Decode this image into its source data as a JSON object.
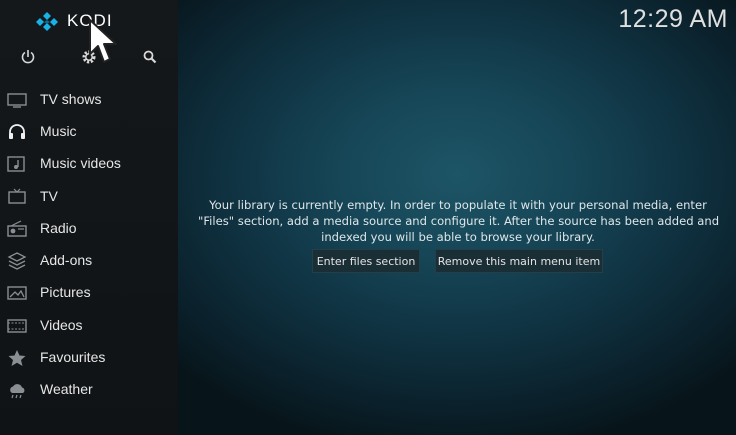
{
  "app": {
    "name": "KODI",
    "clock": "12:29 AM"
  },
  "topbar": {
    "icons": [
      "power-icon",
      "settings-icon",
      "search-icon"
    ]
  },
  "sidebar": {
    "items": [
      {
        "label": "TV shows",
        "icon": "tv-shows-icon"
      },
      {
        "label": "Music",
        "icon": "headphones-icon"
      },
      {
        "label": "Music videos",
        "icon": "music-video-icon"
      },
      {
        "label": "TV",
        "icon": "tv-icon"
      },
      {
        "label": "Radio",
        "icon": "radio-icon"
      },
      {
        "label": "Add-ons",
        "icon": "addons-icon"
      },
      {
        "label": "Pictures",
        "icon": "pictures-icon"
      },
      {
        "label": "Videos",
        "icon": "film-icon"
      },
      {
        "label": "Favourites",
        "icon": "star-icon"
      },
      {
        "label": "Weather",
        "icon": "weather-icon"
      }
    ]
  },
  "main": {
    "message_line1": "Your library is currently empty. In order to populate it with your personal media, enter",
    "message_line2": "\"Files\" section, add a media source and configure it. After the source has been added and",
    "message_line3": "indexed you will be able to browse your library.",
    "enter_files_label": "Enter files section",
    "remove_item_label": "Remove this main menu item"
  },
  "colors": {
    "accent": "#1d5566",
    "logo_blue": "#17b2e7"
  }
}
